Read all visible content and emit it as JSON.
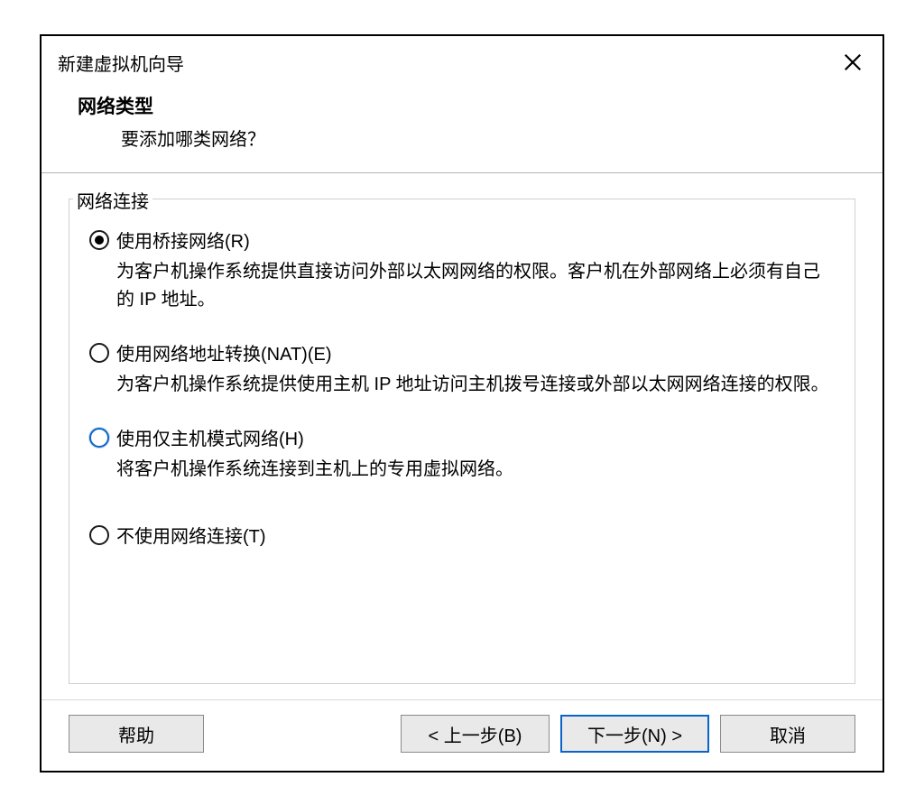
{
  "dialog": {
    "title": "新建虚拟机向导"
  },
  "header": {
    "title": "网络类型",
    "subtitle": "要添加哪类网络？"
  },
  "group": {
    "label": "网络连接"
  },
  "options": {
    "bridged": {
      "label": "使用桥接网络(R)",
      "desc": "为客户机操作系统提供直接访问外部以太网网络的权限。客户机在外部网络上必须有自己的 IP 地址。",
      "checked": true
    },
    "nat": {
      "label": "使用网络地址转换(NAT)(E)",
      "desc": "为客户机操作系统提供使用主机 IP 地址访问主机拨号连接或外部以太网网络连接的权限。",
      "checked": false
    },
    "hostonly": {
      "label": "使用仅主机模式网络(H)",
      "desc": "将客户机操作系统连接到主机上的专用虚拟网络。",
      "checked": false,
      "highlight": true
    },
    "none": {
      "label": "不使用网络连接(T)",
      "checked": false
    }
  },
  "buttons": {
    "help": "帮助",
    "back": "< 上一步(B)",
    "next": "下一步(N) >",
    "cancel": "取消"
  }
}
